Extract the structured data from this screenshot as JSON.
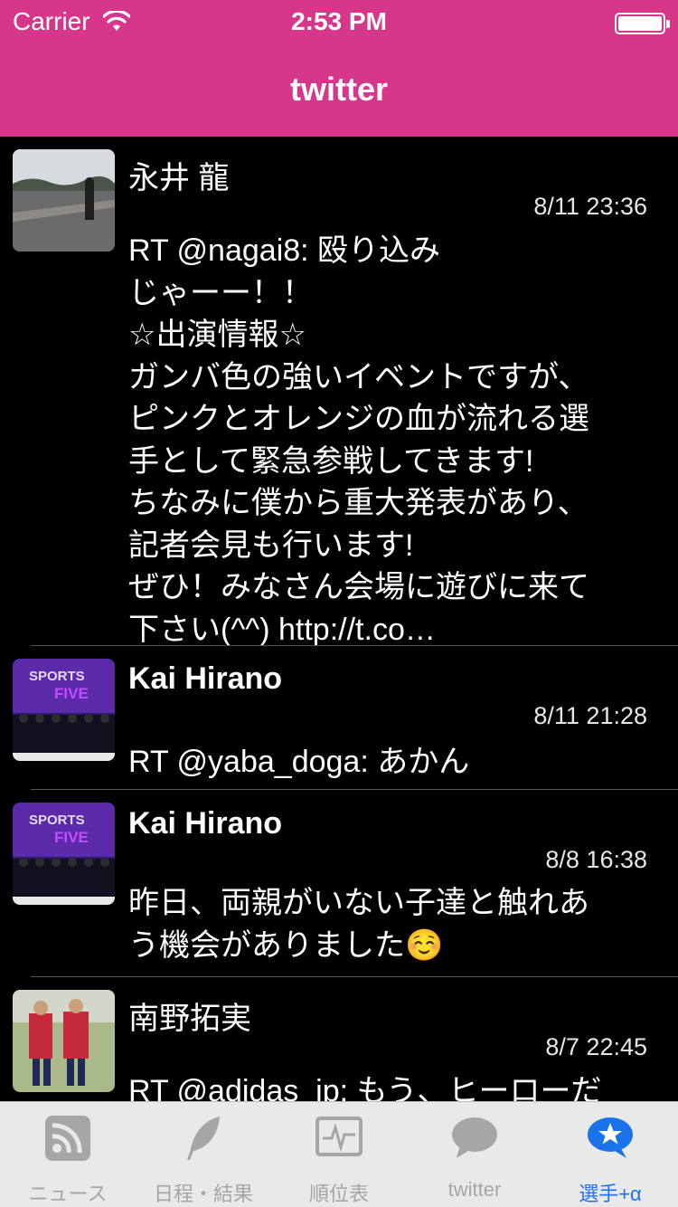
{
  "status_bar": {
    "carrier": "Carrier",
    "time": "2:53 PM"
  },
  "nav": {
    "title": "twitter"
  },
  "tweets": [
    {
      "name": "永井 龍",
      "date": "8/11 23:36",
      "text": "RT @nagai8: 殴り込み\nじゃーー！！\n☆出演情報☆\nガンバ色の強いイベントですが、\nピンクとオレンジの血が流れる選\n手として緊急参戦してきます!\nちなみに僕から重大発表があり、\n記者会見も行います!\nぜひ！みなさん会場に遊びに来て\n下さい(^^) http://t.co…"
    },
    {
      "name": "Kai Hirano",
      "date": "8/11 21:28",
      "text": "RT @yaba_doga: あかん"
    },
    {
      "name": "Kai Hirano",
      "date": "8/8 16:38",
      "text": "昨日、両親がいない子達と触れあ\nう機会がありました☺️"
    },
    {
      "name": "南野拓実",
      "date": "8/7 22:45",
      "text": "RT @adidas_jp: もう、ヒーローだ"
    }
  ],
  "tabbar": {
    "items": [
      {
        "label": "ニュース",
        "icon": "rss-icon"
      },
      {
        "label": "日程・結果",
        "icon": "feather-icon"
      },
      {
        "label": "順位表",
        "icon": "monitor-icon"
      },
      {
        "label": "twitter",
        "icon": "speech-bubble-icon"
      },
      {
        "label": "選手+α",
        "icon": "star-bubble-icon"
      }
    ],
    "active_color": "#1a73e8",
    "inactive_color": "#a6a6a6"
  },
  "colors": {
    "header": "#d6378a",
    "background": "#000000"
  }
}
